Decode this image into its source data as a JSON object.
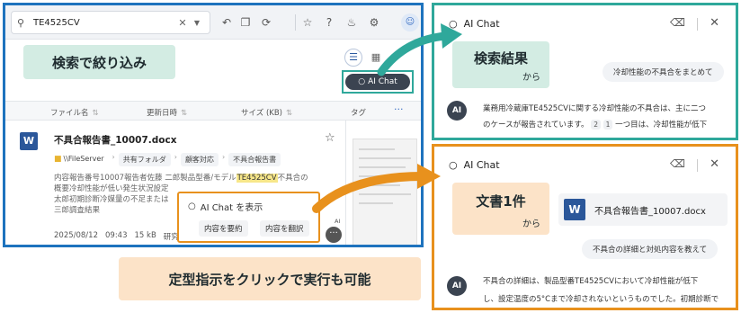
{
  "colors": {
    "left_frame": "#1e73be",
    "right_top_frame": "#2fa89b",
    "right_bottom_frame": "#e8911d",
    "callout_green": "#d3ece3",
    "callout_orange": "#fce3c8",
    "highlight": "#f7e78a"
  },
  "search": {
    "value": "TE4525CV",
    "icon": "search-icon",
    "clear_icon": "close-icon",
    "dropdown_icon": "caret-down-icon"
  },
  "toolbar": {
    "icons": [
      "undo-icon",
      "copy-icon",
      "history-icon",
      "star-icon",
      "help-icon",
      "bell-icon",
      "settings-icon",
      "user-icon"
    ]
  },
  "callouts": {
    "filter": "検索で絞り込み",
    "click": "定型指示をクリックで実行も可能",
    "search_results_main": "検索結果",
    "search_results_sub": "から",
    "single_doc_main": "文書1件",
    "single_doc_sub": "から"
  },
  "ai_chat_button": "AI Chat",
  "table": {
    "headers": {
      "file_name": "ファイル名",
      "updated_at": "更新日時",
      "size": "サイズ (KB)",
      "tags": "タグ"
    },
    "sort_icon": "⇅",
    "more": "···"
  },
  "result": {
    "icon_letter": "W",
    "title": "不具合報告書_10007.docx",
    "path": {
      "server": "\\\\FileServer",
      "folders": [
        "共有フォルダ",
        "顧客対応",
        "不具合報告書"
      ]
    },
    "snippet": {
      "line1_before": "内容報告番号10007報告者佐藤 二郎製品型番/モデル",
      "line1_mark": "TE4525CV",
      "line1_after": "不具合の",
      "line2": "概要冷却性能が低い発生状況設定",
      "line3": "太郎初期診断冷媒量の不足または",
      "line4": "三郎調査結果"
    },
    "date": "2025/08/12",
    "time": "09:43",
    "size": "15",
    "size_unit": "kB",
    "tag": "研究"
  },
  "ai_popup": {
    "title": "AI Chat を表示",
    "actions": [
      "内容を要約",
      "内容を翻訳"
    ],
    "mini_label": "AI"
  },
  "chat_top": {
    "title": "AI Chat",
    "user_message": "冷却性能の不具合をまとめて",
    "avatar": "AI",
    "answer_line1": "業務用冷蔵庫TE4525CVに関する冷却性能の不具合は、主に二つ",
    "answer_line2_before": "のケースが報告されています。",
    "citations": [
      "2",
      "1"
    ],
    "answer_line2_after": "一つ目は、冷却性能が低下"
  },
  "chat_bottom": {
    "title": "AI Chat",
    "doc_icon_letter": "W",
    "doc_name": "不具合報告書_10007.docx",
    "user_message": "不具合の詳細と対処内容を教えて",
    "avatar": "AI",
    "answer_line1": "不具合の詳細は、製品型番TE4525CVにおいて冷却性能が低下",
    "answer_line2": "し、設定温度の5°Cまで冷却されないというものでした。初期診断で"
  }
}
